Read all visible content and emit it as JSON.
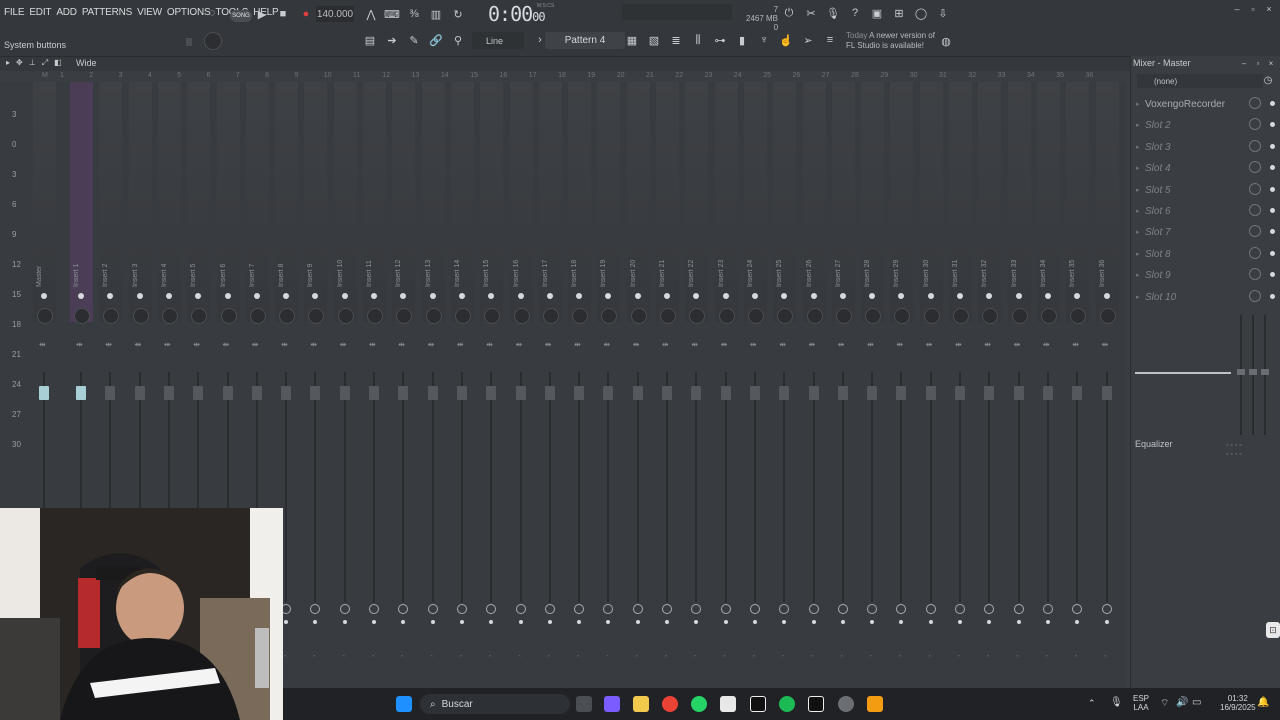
{
  "menu": [
    "FILE",
    "EDIT",
    "ADD",
    "PATTERNS",
    "VIEW",
    "OPTIONS",
    "TOOLS",
    "HELP"
  ],
  "transport": {
    "song_label": "SONG",
    "tempo": "140.000",
    "time": "0:00",
    "time_frames": "00",
    "time_unit": "M:S:CS"
  },
  "memory": {
    "cpu": "7",
    "mb": "2467 MB",
    "poly": "0"
  },
  "toolbar": {
    "hint": "System buttons",
    "snap": "Line",
    "pattern": "Pattern 4"
  },
  "news": {
    "date": "Today",
    "line1": "A newer version of",
    "line2": "FL Studio is available!"
  },
  "mixer": {
    "view": "Wide",
    "master_label": "Master",
    "scale": [
      "3",
      "0",
      "3",
      "6",
      "9",
      "12",
      "15",
      "18",
      "21",
      "24",
      "27",
      "30"
    ]
  },
  "ruler": [
    "M",
    "1",
    "2",
    "3",
    "4",
    "5",
    "6",
    "7",
    "8",
    "9",
    "10",
    "11",
    "12",
    "13",
    "14",
    "15",
    "16",
    "17",
    "18",
    "19",
    "20",
    "21",
    "22",
    "23",
    "24",
    "25",
    "26",
    "27",
    "28",
    "29",
    "30",
    "31",
    "32",
    "33",
    "34",
    "35",
    "36"
  ],
  "inserts": [
    "Insert 1",
    "Insert 2",
    "Insert 3",
    "Insert 4",
    "Insert 5",
    "Insert 6",
    "Insert 7",
    "Insert 8",
    "Insert 9",
    "Insert 10",
    "Insert 11",
    "Insert 12",
    "Insert 13",
    "Insert 14",
    "Insert 15",
    "Insert 16",
    "Insert 17",
    "Insert 18",
    "Insert 19",
    "Insert 20",
    "Insert 21",
    "Insert 22",
    "Insert 23",
    "Insert 24",
    "Insert 25",
    "Insert 26",
    "Insert 27",
    "Insert 28",
    "Insert 29",
    "Insert 30",
    "Insert 31",
    "Insert 32",
    "Insert 33",
    "Insert 34",
    "Insert 35",
    "Insert 36"
  ],
  "panel": {
    "title": "Mixer - Master",
    "input": "(none)",
    "slots": [
      "VoxengoRecorder",
      "Slot 2",
      "Slot 3",
      "Slot 4",
      "Slot 5",
      "Slot 6",
      "Slot 7",
      "Slot 8",
      "Slot 9",
      "Slot 10"
    ],
    "eq_label": "Equalizer"
  },
  "taskbar": {
    "search": "Buscar",
    "lang1": "ESP",
    "lang2": "LAA",
    "time": "01:32",
    "date": "16/9/2025"
  },
  "colors": {
    "selected_strip": "#4b3d55",
    "accent_fader": "#a9cfd6",
    "record": "#e04040",
    "spotify": "#1db954",
    "windows": "#1e90ff"
  }
}
